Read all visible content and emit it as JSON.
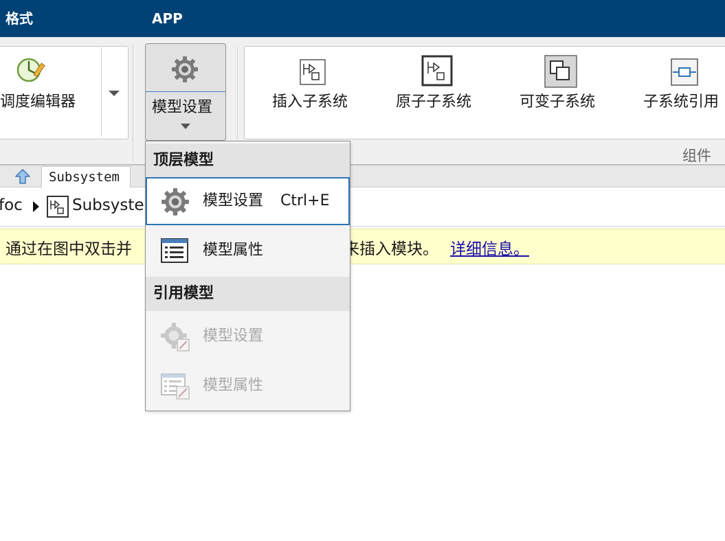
{
  "top_tabs": {
    "format": "格式",
    "app": "APP"
  },
  "ribbon": {
    "schedule_editor": "调度编辑器",
    "model_settings": "模型设置",
    "insert_subsystem": "插入子系统",
    "atomic_subsystem": "原子子系统",
    "variant_subsystem": "可变子系统",
    "subsystem_reference": "子系统引用",
    "group_component": "组件"
  },
  "editor_tab": {
    "label": "Subsystem"
  },
  "path": {
    "model": "foc",
    "subsystem": "Subsystem"
  },
  "infobar": {
    "text_left": "通过在图中双击并",
    "text_right": "来插入模块。",
    "link": "详细信息。"
  },
  "menu": {
    "top_model_header": "顶层模型",
    "top_model_settings": "模型设置",
    "top_model_settings_shortcut": "Ctrl+E",
    "top_model_properties": "模型属性",
    "ref_model_header": "引用模型",
    "ref_model_settings": "模型设置",
    "ref_model_properties": "模型属性"
  },
  "colors": {
    "accent": "#004275",
    "info_bg": "#ffffcc",
    "link": "#1a0dab",
    "focus": "#2e74b5"
  },
  "icons": [
    "schedule-editor-icon",
    "gear-icon",
    "chevron-down-icon",
    "insert-subsystem-icon",
    "atomic-subsystem-icon",
    "variant-subsystem-icon",
    "subsystem-reference-icon",
    "up-arrow-icon",
    "subsystem-icon",
    "model-properties-icon"
  ]
}
